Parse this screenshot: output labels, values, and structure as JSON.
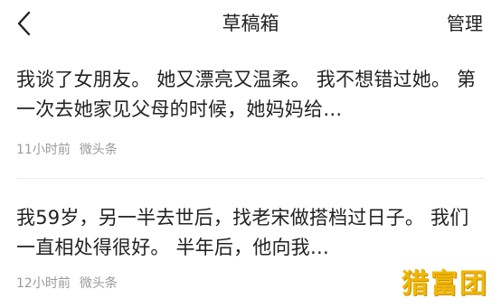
{
  "navbar": {
    "title": "草稿箱",
    "manage_label": "管理"
  },
  "drafts": [
    {
      "text": "我谈了女朋友。 她又漂亮又温柔。 我不想错过她。 第一次去她家见父母的时候，她妈妈给…",
      "time": "11小时前",
      "source": "微头条"
    },
    {
      "text": "我59岁，另一半去世后，找老宋做搭档过日子。 我们一直相处得很好。 半年后，他向我…",
      "time": "12小时前",
      "source": "微头条"
    }
  ],
  "watermark": "猎富团",
  "icons": {
    "back": "back-arrow-icon"
  }
}
